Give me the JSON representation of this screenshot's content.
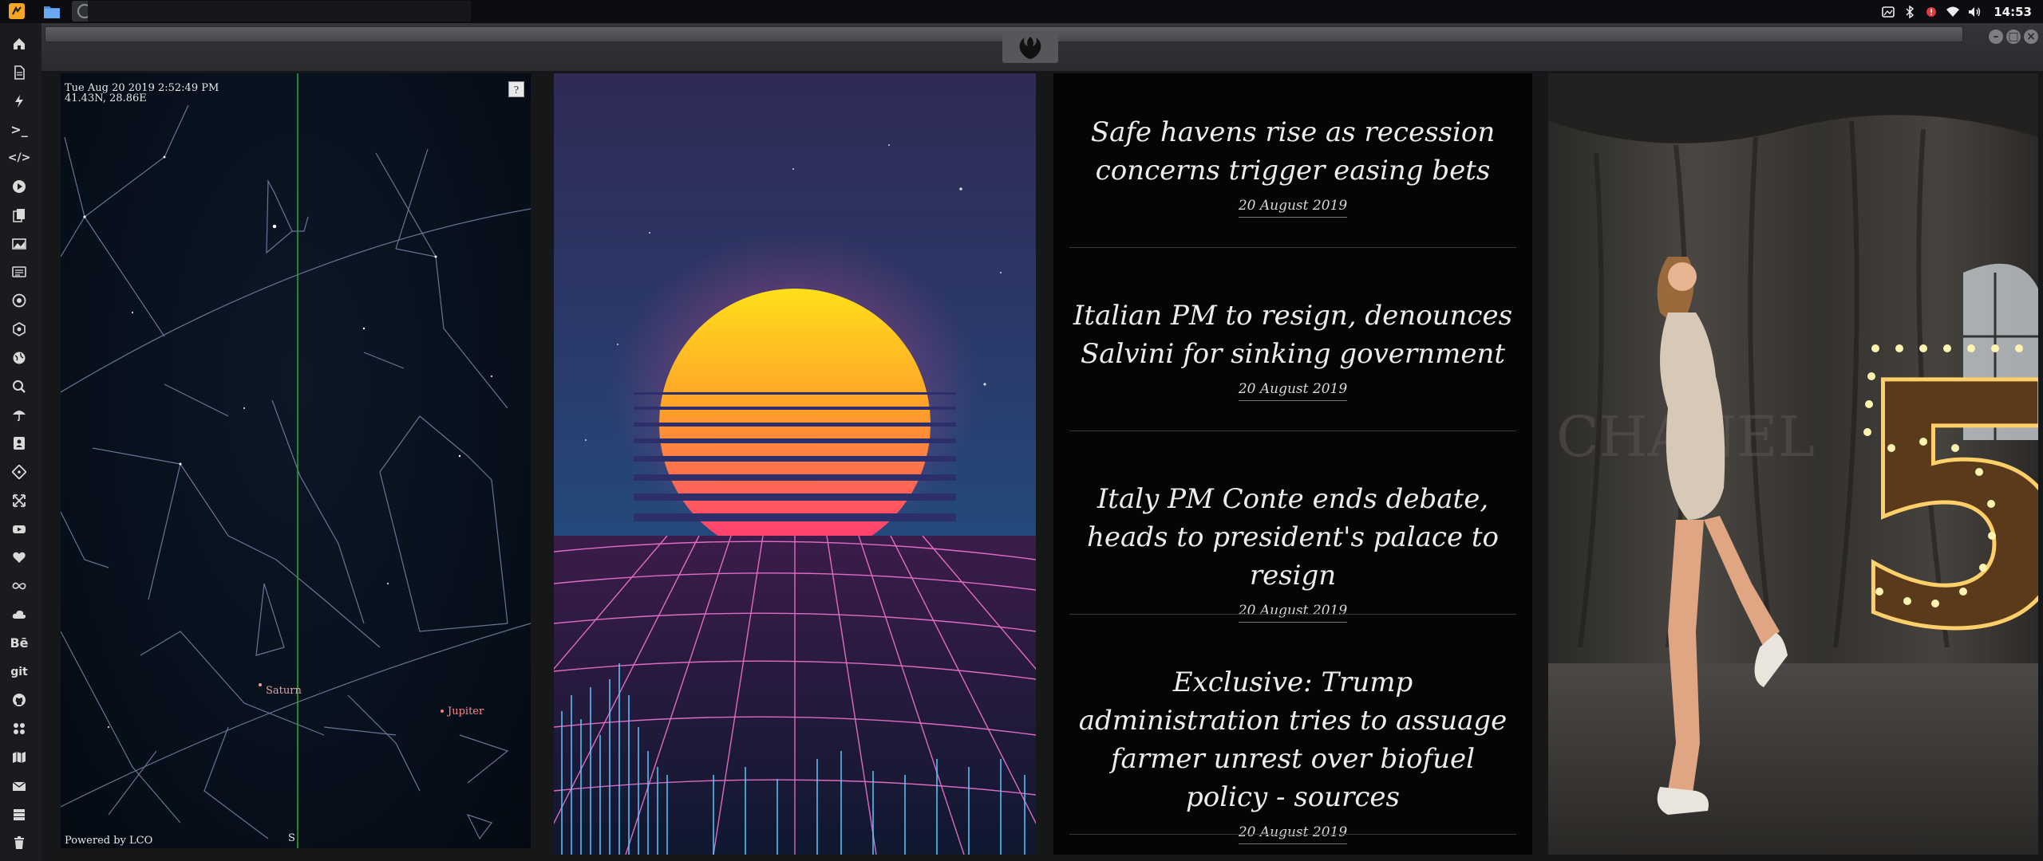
{
  "system": {
    "clock": "14:53",
    "launchers": [
      "app-launcher-icon",
      "files-icon",
      "workspace-icon"
    ],
    "tray_icons": [
      "screenshot-icon",
      "bluetooth-icon",
      "alert-icon",
      "wifi-icon",
      "volume-icon"
    ]
  },
  "dock": {
    "items": [
      {
        "icon": "home-icon"
      },
      {
        "icon": "document-icon"
      },
      {
        "icon": "bolt-icon"
      },
      {
        "icon": "terminal-icon",
        "label": ">_"
      },
      {
        "icon": "code-icon",
        "label": "</>"
      },
      {
        "icon": "play-icon"
      },
      {
        "icon": "files-icon"
      },
      {
        "icon": "image-icon"
      },
      {
        "icon": "news-icon"
      },
      {
        "icon": "aperture-icon"
      },
      {
        "icon": "settings-icon"
      },
      {
        "icon": "globe-icon"
      },
      {
        "icon": "search-icon"
      },
      {
        "icon": "umbrella-icon"
      },
      {
        "icon": "contact-icon"
      },
      {
        "icon": "git-icon"
      },
      {
        "icon": "expand-icon"
      },
      {
        "icon": "youtube-icon"
      },
      {
        "icon": "heart-icon"
      },
      {
        "icon": "infinity-icon"
      },
      {
        "icon": "cloud-icon"
      },
      {
        "icon": "behance-icon",
        "label": "Bē"
      },
      {
        "icon": "git-text-icon",
        "label": "git"
      },
      {
        "icon": "github-icon"
      },
      {
        "icon": "network-icon"
      },
      {
        "icon": "map-icon"
      },
      {
        "icon": "mail-icon"
      },
      {
        "icon": "server-icon"
      },
      {
        "icon": "trash-icon"
      }
    ]
  },
  "window": {
    "logo_icon": "rebel-alliance-icon",
    "buttons": [
      "minimize-button",
      "maximize-button",
      "close-button"
    ]
  },
  "sky": {
    "datetime": "Tue Aug 20 2019 2:52:49 PM",
    "coords": "41.43N, 28.86E",
    "help": "?",
    "planets": [
      "Saturn",
      "Jupiter"
    ],
    "compass": "S",
    "credit": "Powered by LCO"
  },
  "news": {
    "items": [
      {
        "title": "Safe havens rise as recession concerns trigger easing bets",
        "date": "20 August 2019"
      },
      {
        "title": "Italian PM to resign, denounces Salvini for sinking government",
        "date": "20 August 2019"
      },
      {
        "title": "Italy PM Conte ends debate, heads to president's palace to resign",
        "date": "20 August 2019"
      },
      {
        "title": "Exclusive: Trump administration tries to assuage farmer unrest over biofuel policy - sources",
        "date": "20 August 2019"
      }
    ]
  },
  "photo": {
    "sign_number": "5",
    "backdrop_text": "CHANEL"
  },
  "colors": {
    "accent_orange": "#f5a623",
    "sun_top": "#ffd21a",
    "sun_bottom": "#ff3a7a",
    "grid_pink": "#ff6bd6",
    "grid_blue": "#5fc6ff"
  }
}
